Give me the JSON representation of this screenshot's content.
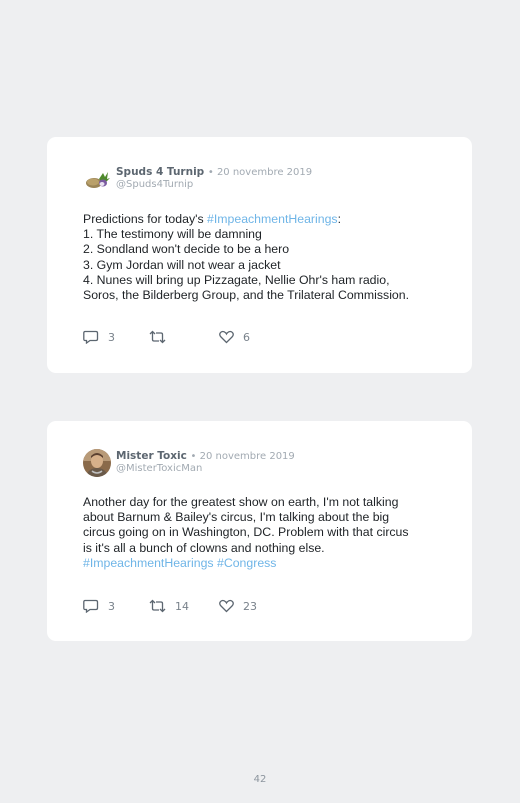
{
  "tweets": [
    {
      "name": "Spuds 4 Turnip",
      "date": "20 novembre 2019",
      "handle": "@Spuds4Turnip",
      "lines": [
        [
          {
            "t": "Predictions for today's "
          },
          {
            "t": "#ImpeachmentHearings",
            "tag": true
          },
          {
            "t": ":"
          }
        ],
        [
          {
            "t": "1. The testimony will be damning"
          }
        ],
        [
          {
            "t": "2. Sondland won't decide to be a hero"
          }
        ],
        [
          {
            "t": "3. Gym Jordan will not wear a jacket"
          }
        ],
        [
          {
            "t": "4. Nunes will bring up Pizzagate, Nellie Ohr's ham radio,"
          }
        ],
        [
          {
            "t": "Soros, the Bilderberg Group, and the Trilateral Commission."
          }
        ]
      ],
      "replies": "3",
      "retweets": "",
      "likes": "6"
    },
    {
      "name": "Mister Toxic",
      "date": "20 novembre 2019",
      "handle": "@MisterToxicMan",
      "lines": [
        [
          {
            "t": "Another day for the greatest show on earth, I'm not talking"
          }
        ],
        [
          {
            "t": "about Barnum & Bailey's circus, I'm talking about the big"
          }
        ],
        [
          {
            "t": "circus going on in Washington, DC. Problem with that circus"
          }
        ],
        [
          {
            "t": "is it's all a bunch of clowns and nothing else."
          }
        ],
        [
          {
            "t": "#ImpeachmentHearings",
            "tag": true
          },
          {
            "t": " "
          },
          {
            "t": "#Congress",
            "tag": true
          }
        ]
      ],
      "replies": "3",
      "retweets": "14",
      "likes": "23"
    }
  ],
  "page_number": "42",
  "colors": {
    "hashtag": "#6fb5e7",
    "card": "#ffffff",
    "background": "#eeeff1"
  }
}
